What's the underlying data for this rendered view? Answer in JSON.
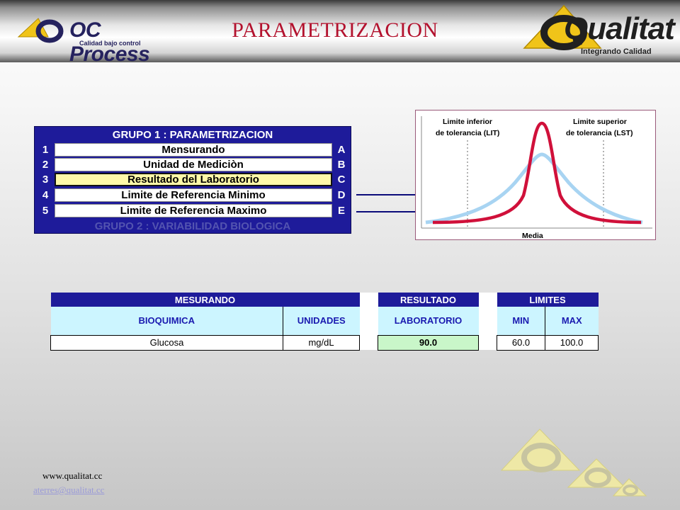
{
  "header": {
    "title": "PARAMETRIZACION",
    "left_logo": {
      "name": "OC Process",
      "tagline": "Calidad bajo control"
    },
    "right_logo": {
      "name": "Qualitat",
      "tagline": "Integrando Calidad"
    }
  },
  "grupo1": {
    "title": "GRUPO 1 : PARAMETRIZACION",
    "rows": [
      {
        "num": "1",
        "label": "Mensurando",
        "letter": "A"
      },
      {
        "num": "2",
        "label": "Unidad de Mediciòn",
        "letter": "B"
      },
      {
        "num": "3",
        "label": "Resultado del Laboratorio",
        "letter": "C"
      },
      {
        "num": "4",
        "label": "Limite de Referencia Minimo",
        "letter": "D"
      },
      {
        "num": "5",
        "label": "Limite de Referencia Maximo",
        "letter": "E"
      }
    ],
    "next_group": "GRUPO 2 : VARIABILIDAD BIOLOGICA"
  },
  "curve": {
    "lit_line1": "Limite inferior",
    "lit_line2": "de tolerancia (LIT)",
    "lst_line1": "Limite superior",
    "lst_line2": "de tolerancia (LST)",
    "x_label": "Media"
  },
  "table": {
    "group_headers": {
      "mesurando": "MESURANDO",
      "resultado": "RESULTADO",
      "limites": "LIMITES"
    },
    "col_headers": {
      "bioquimica": "BIOQUIMICA",
      "unidades": "UNIDADES",
      "laboratorio": "LABORATORIO",
      "min": "MIN",
      "max": "MAX"
    },
    "row": {
      "bioquimica": "Glucosa",
      "unidades": "mg/dL",
      "laboratorio": "90.0",
      "min": "60.0",
      "max": "100.0"
    }
  },
  "footer": {
    "website": "www.qualitat.cc",
    "email": "aterres@qualitat.cc"
  },
  "colors": {
    "title_red": "#b3122e",
    "panel_blue": "#1e1b9a",
    "header_light": "#ccf5ff",
    "result_green": "#c9f6c9",
    "curve_red": "#d0103a",
    "curve_blue": "#a8d4f2"
  }
}
